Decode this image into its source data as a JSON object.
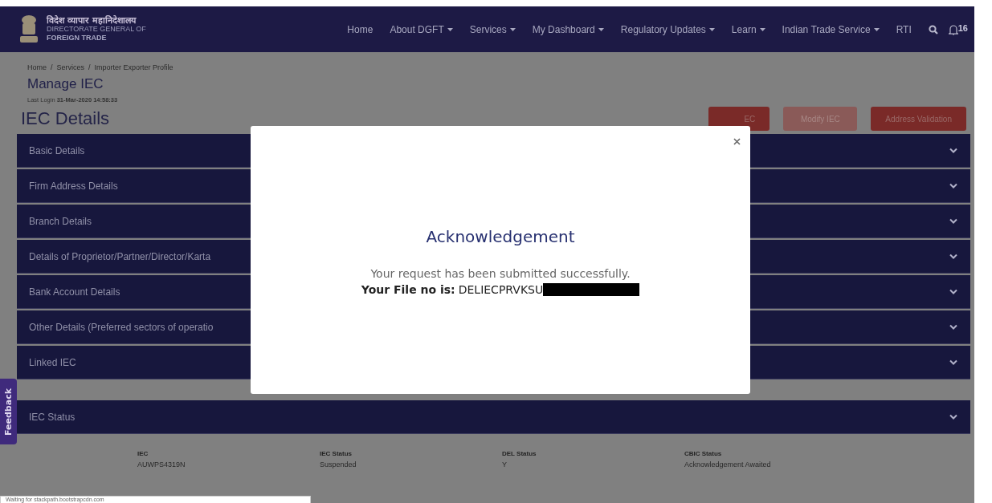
{
  "header": {
    "logo_hindi": "विदेश व्यापार महानिदेशालय",
    "logo_line1": "DIRECTORATE GENERAL OF",
    "logo_line2": "FOREIGN TRADE",
    "nav": [
      {
        "label": "Home",
        "dropdown": false
      },
      {
        "label": "About DGFT",
        "dropdown": true
      },
      {
        "label": "Services",
        "dropdown": true
      },
      {
        "label": "My Dashboard",
        "dropdown": true
      },
      {
        "label": "Regulatory Updates",
        "dropdown": true
      },
      {
        "label": "Learn",
        "dropdown": true
      },
      {
        "label": "Indian Trade Service",
        "dropdown": true
      },
      {
        "label": "RTI",
        "dropdown": false
      }
    ],
    "notification_count": "16"
  },
  "breadcrumb": {
    "separator": "/",
    "items": [
      "Home",
      "Services",
      "Importer Exporter Profile"
    ]
  },
  "page_title": "Manage IEC",
  "last_login": {
    "label": "Last Login",
    "value": "31-Mar-2020 14:58:33"
  },
  "section_title": "IEC Details",
  "actions": [
    {
      "label": "EC",
      "disabled": false
    },
    {
      "label": "Modify IEC",
      "disabled": true
    },
    {
      "label": "Address Validation",
      "disabled": false
    }
  ],
  "accordions": [
    "Basic Details",
    "Firm Address Details",
    "Branch Details",
    "Details of Proprietor/Partner/Director/Karta",
    "Bank Account Details",
    "Other Details (Preferred sectors of operatio",
    "Linked IEC"
  ],
  "status_panel": {
    "title": "IEC Status",
    "columns": [
      "IEC",
      "IEC Status",
      "DEL Status",
      "CBIC Status"
    ],
    "row": [
      "AUWPS4319N",
      "Suspended",
      "Y",
      "Acknowledgement Awaited"
    ]
  },
  "feedback": "Feedback",
  "modal": {
    "title": "Acknowledgement",
    "message": "Your request has been submitted successfully.",
    "file_label": "Your File no is:",
    "file_value": "DELIECPRVKSU",
    "redacted": true
  },
  "browser_status": "Waiting for stackpath.bootstrapcdn.com"
}
